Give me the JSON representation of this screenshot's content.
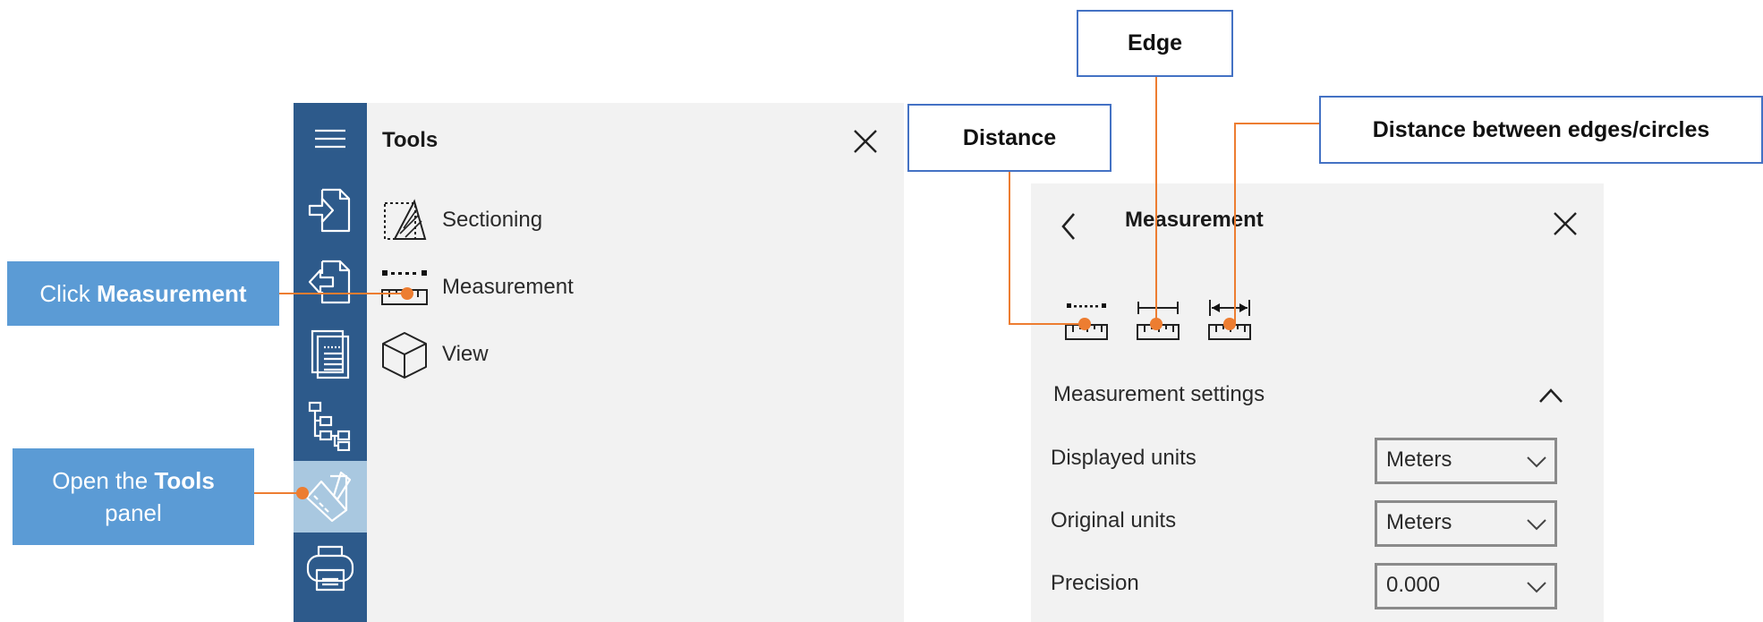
{
  "sidebar": {
    "items": [
      {
        "icon": "hamburger-menu-icon"
      },
      {
        "icon": "import-file-icon"
      },
      {
        "icon": "export-file-icon"
      },
      {
        "icon": "document-pages-icon"
      },
      {
        "icon": "model-tree-icon"
      },
      {
        "icon": "tools-icon",
        "active": true
      },
      {
        "icon": "printer-icon"
      }
    ]
  },
  "tools_panel": {
    "title": "Tools",
    "items": [
      {
        "label": "Sectioning",
        "icon": "sectioning-icon"
      },
      {
        "label": "Measurement",
        "icon": "measurement-ruler-icon"
      },
      {
        "label": "View",
        "icon": "cube-view-icon"
      }
    ]
  },
  "measurement_panel": {
    "title": "Measurement",
    "tools": [
      {
        "icon": "distance-ruler-icon"
      },
      {
        "icon": "edge-ruler-icon"
      },
      {
        "icon": "distance-between-edges-icon"
      }
    ],
    "settings": {
      "title": "Measurement settings",
      "rows": [
        {
          "label": "Displayed units",
          "value": "Meters"
        },
        {
          "label": "Original units",
          "value": "Meters"
        },
        {
          "label": "Precision",
          "value": "0.000"
        }
      ]
    }
  },
  "callouts": {
    "click_measurement": {
      "prefix": "Click ",
      "bold": "Measurement"
    },
    "open_tools": {
      "prefix": "Open the ",
      "bold": "Tools",
      "suffix": "panel"
    },
    "distance": "Distance",
    "edge": "Edge",
    "distance_between": "Distance between edges/circles"
  },
  "colors": {
    "sidebar": "#2d5a8b",
    "sidebar_active": "#a9c8e0",
    "panel_bg": "#f2f2f2",
    "callout_blue": "#5b9bd5",
    "callout_border": "#4472c4",
    "leader_line": "#ed7d31"
  }
}
